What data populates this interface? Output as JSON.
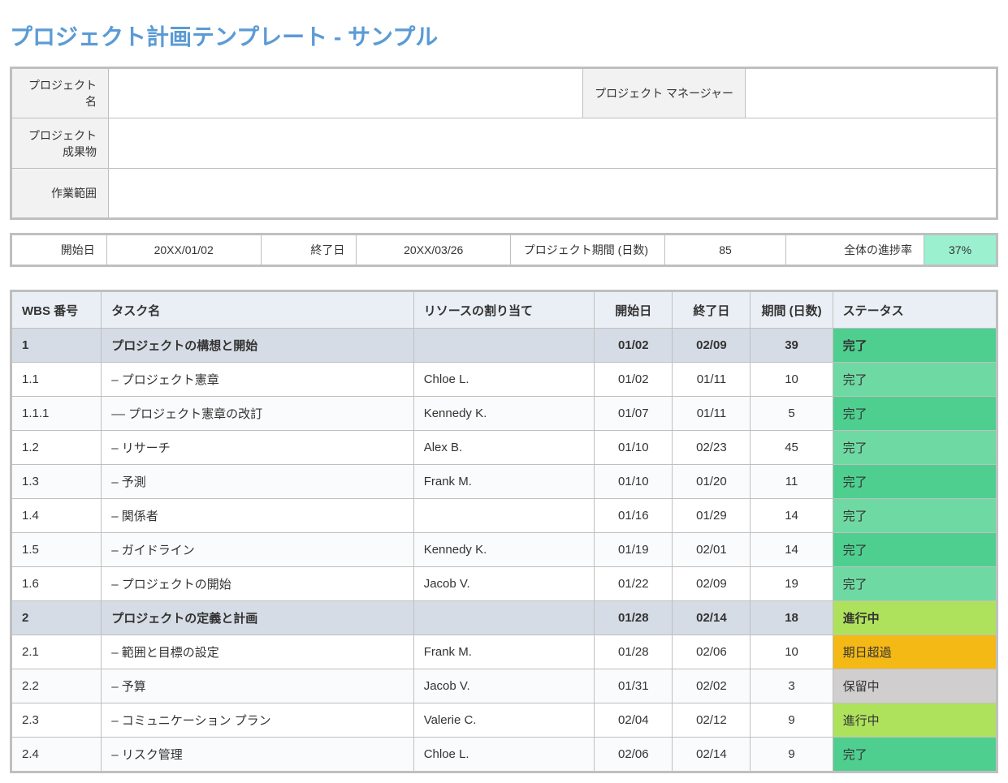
{
  "title": "プロジェクト計画テンプレート - サンプル",
  "info": {
    "project_name_label": "プロジェクト名",
    "project_name": "",
    "manager_label": "プロジェクト マネージャー",
    "manager": "",
    "deliverable_label": "プロジェクト\n成果物",
    "deliverable": "",
    "scope_label": "作業範囲",
    "scope": ""
  },
  "summary": {
    "start_label": "開始日",
    "start": "20XX/01/02",
    "end_label": "終了日",
    "end": "20XX/03/26",
    "duration_label": "プロジェクト期間 (日数)",
    "duration": "85",
    "progress_label": "全体の進捗率",
    "progress": "37%"
  },
  "headers": {
    "wbs": "WBS 番号",
    "task": "タスク名",
    "resource": "リソースの割り当て",
    "start": "開始日",
    "end": "終了日",
    "duration": "期間 (日数)",
    "status": "ステータス"
  },
  "status_colors": {
    "完了": "#4ecf90",
    "進行中": "#aee25c",
    "期日超過": "#f5b915",
    "保留中": "#d0cece"
  },
  "rows": [
    {
      "group": true,
      "wbs": "1",
      "task": "プロジェクトの構想と開始",
      "resource": "",
      "start": "01/02",
      "end": "02/09",
      "duration": "39",
      "status": "完了",
      "status_class": "status-complete"
    },
    {
      "group": false,
      "wbs": "1.1",
      "task": "– プロジェクト憲章",
      "resource": "Chloe L.",
      "start": "01/02",
      "end": "01/11",
      "duration": "10",
      "status": "完了",
      "status_class": "status-complete-alt"
    },
    {
      "group": false,
      "wbs": "1.1.1",
      "task": "–– プロジェクト憲章の改訂",
      "resource": "Kennedy K.",
      "start": "01/07",
      "end": "01/11",
      "duration": "5",
      "status": "完了",
      "status_class": "status-complete"
    },
    {
      "group": false,
      "wbs": "1.2",
      "task": "– リサーチ",
      "resource": "Alex B.",
      "start": "01/10",
      "end": "02/23",
      "duration": "45",
      "status": "完了",
      "status_class": "status-complete-alt"
    },
    {
      "group": false,
      "wbs": "1.3",
      "task": "– 予測",
      "resource": "Frank M.",
      "start": "01/10",
      "end": "01/20",
      "duration": "11",
      "status": "完了",
      "status_class": "status-complete"
    },
    {
      "group": false,
      "wbs": "1.4",
      "task": "– 関係者",
      "resource": "",
      "start": "01/16",
      "end": "01/29",
      "duration": "14",
      "status": "完了",
      "status_class": "status-complete-alt"
    },
    {
      "group": false,
      "wbs": "1.5",
      "task": "– ガイドライン",
      "resource": "Kennedy K.",
      "start": "01/19",
      "end": "02/01",
      "duration": "14",
      "status": "完了",
      "status_class": "status-complete"
    },
    {
      "group": false,
      "wbs": "1.6",
      "task": "– プロジェクトの開始",
      "resource": "Jacob V.",
      "start": "01/22",
      "end": "02/09",
      "duration": "19",
      "status": "完了",
      "status_class": "status-complete-alt"
    },
    {
      "group": true,
      "wbs": "2",
      "task": "プロジェクトの定義と計画",
      "resource": "",
      "start": "01/28",
      "end": "02/14",
      "duration": "18",
      "status": "進行中",
      "status_class": "status-inprogress"
    },
    {
      "group": false,
      "wbs": "2.1",
      "task": "– 範囲と目標の設定",
      "resource": "Frank M.",
      "start": "01/28",
      "end": "02/06",
      "duration": "10",
      "status": "期日超過",
      "status_class": "status-overdue"
    },
    {
      "group": false,
      "wbs": "2.2",
      "task": "– 予算",
      "resource": "Jacob V.",
      "start": "01/31",
      "end": "02/02",
      "duration": "3",
      "status": "保留中",
      "status_class": "status-onhold"
    },
    {
      "group": false,
      "wbs": "2.3",
      "task": "– コミュニケーション プラン",
      "resource": "Valerie C.",
      "start": "02/04",
      "end": "02/12",
      "duration": "9",
      "status": "進行中",
      "status_class": "status-inprogress"
    },
    {
      "group": false,
      "wbs": "2.4",
      "task": "– リスク管理",
      "resource": "Chloe L.",
      "start": "02/06",
      "end": "02/14",
      "duration": "9",
      "status": "完了",
      "status_class": "status-complete"
    }
  ]
}
